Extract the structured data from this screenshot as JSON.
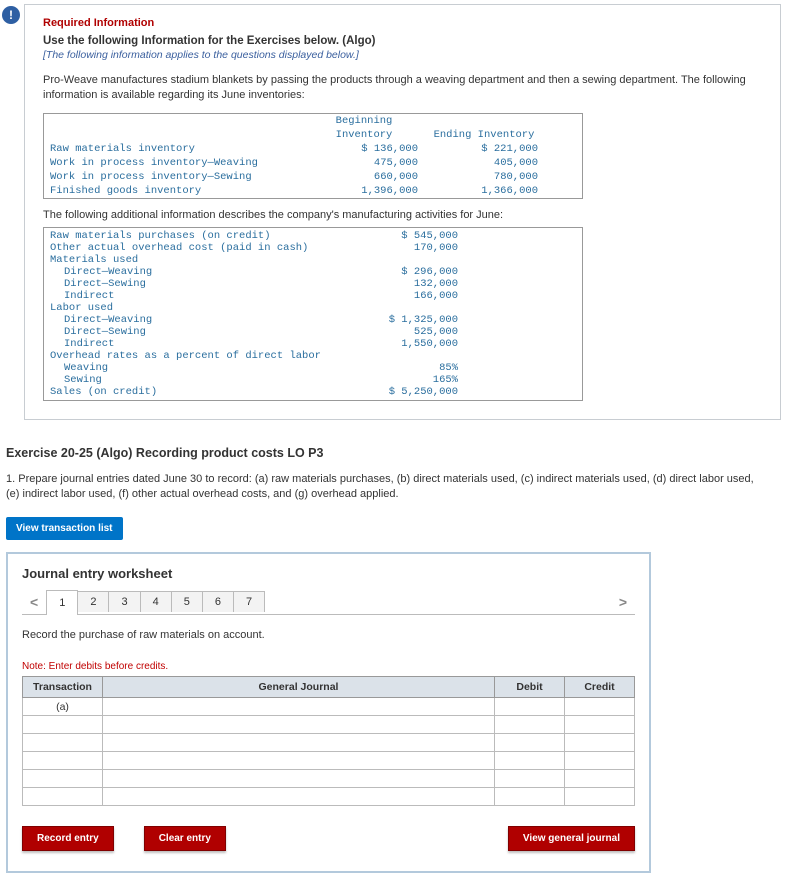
{
  "header": {
    "required": "Required Information",
    "use": "Use the following Information for the Exercises below. (Algo)",
    "italic": "[The following information applies to the questions displayed below.]",
    "para": "Pro-Weave manufactures stadium blankets by passing the products through a weaving department and then a sewing department. The following information is available regarding its June inventories:"
  },
  "inv_table": {
    "h1a": "Beginning",
    "h1b": "Inventory",
    "h2": "Ending Inventory",
    "rows": [
      {
        "label": "Raw materials inventory",
        "c1": "$ 136,000",
        "c2": "$ 221,000"
      },
      {
        "label": "Work in process inventory—Weaving",
        "c1": "475,000",
        "c2": "405,000"
      },
      {
        "label": "Work in process inventory—Sewing",
        "c1": "660,000",
        "c2": "780,000"
      },
      {
        "label": "Finished goods inventory",
        "c1": "1,396,000",
        "c2": "1,366,000"
      }
    ]
  },
  "desc2": "The following additional information describes the company's manufacturing activities for June:",
  "act_table": {
    "rows": [
      {
        "label": "Raw materials purchases (on credit)",
        "val": "$ 545,000",
        "indent": 0
      },
      {
        "label": "Other actual overhead cost (paid in cash)",
        "val": "170,000",
        "indent": 0
      },
      {
        "label": "Materials used",
        "val": "",
        "indent": 0
      },
      {
        "label": "Direct—Weaving",
        "val": "$ 296,000",
        "indent": 1
      },
      {
        "label": "Direct—Sewing",
        "val": "132,000",
        "indent": 1
      },
      {
        "label": "Indirect",
        "val": "166,000",
        "indent": 1
      },
      {
        "label": "Labor used",
        "val": "",
        "indent": 0
      },
      {
        "label": "Direct—Weaving",
        "val": "$ 1,325,000",
        "indent": 1
      },
      {
        "label": "Direct—Sewing",
        "val": "525,000",
        "indent": 1
      },
      {
        "label": "Indirect",
        "val": "1,550,000",
        "indent": 1
      },
      {
        "label": "Overhead rates as a percent of direct labor",
        "val": "",
        "indent": 0
      },
      {
        "label": "Weaving",
        "val": "85%",
        "indent": 1
      },
      {
        "label": "Sewing",
        "val": "165%",
        "indent": 1
      },
      {
        "label": "Sales (on credit)",
        "val": "$ 5,250,000",
        "indent": 0
      }
    ]
  },
  "exercise": {
    "title": "Exercise 20-25 (Algo) Recording product costs LO P3",
    "q1": "1. Prepare journal entries dated June 30 to record: (a) raw materials purchases, (b) direct materials used, (c) indirect materials used, (d) direct labor used, (e) indirect labor used, (f) other actual overhead costs, and (g) overhead applied.",
    "vtl": "View transaction list"
  },
  "worksheet": {
    "title": "Journal entry worksheet",
    "tabs": [
      "1",
      "2",
      "3",
      "4",
      "5",
      "6",
      "7"
    ],
    "chev_left": "<",
    "chev_right": ">",
    "instruction": "Record the purchase of raw materials on account.",
    "note": "Note: Enter debits before credits.",
    "headers": {
      "tx": "Transaction",
      "gj": "General Journal",
      "debit": "Debit",
      "credit": "Credit"
    },
    "first_tx": "(a)",
    "buttons": {
      "record": "Record entry",
      "clear": "Clear entry",
      "view": "View general journal"
    }
  }
}
